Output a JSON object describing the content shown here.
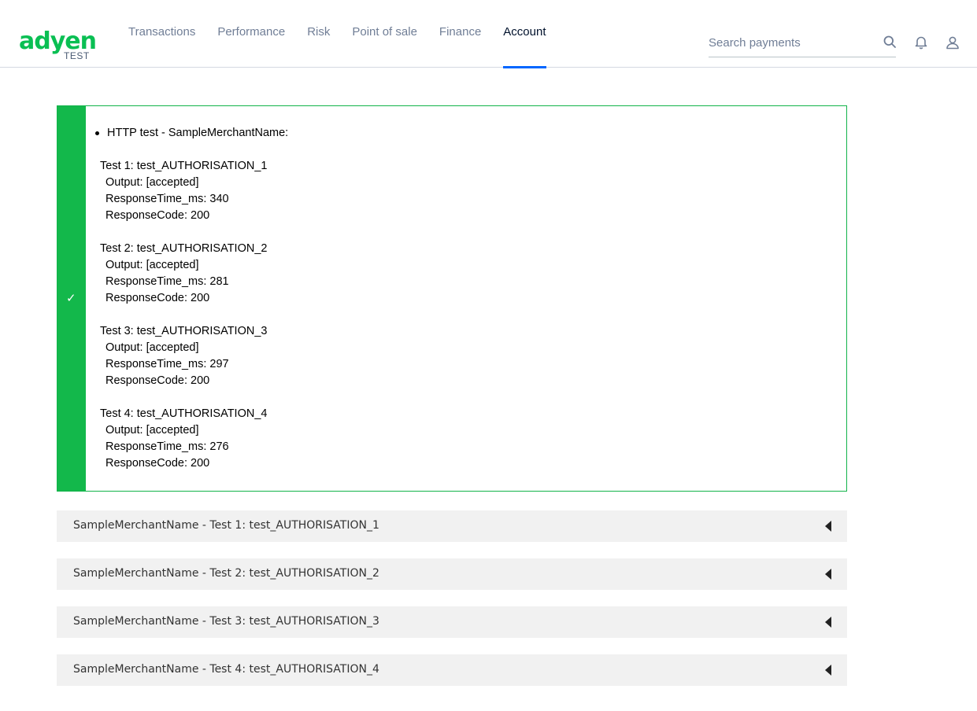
{
  "brand": {
    "logo": "adyen",
    "sub": "TEST",
    "color": "#0abf53"
  },
  "nav": [
    {
      "label": "Transactions",
      "active": false
    },
    {
      "label": "Performance",
      "active": false
    },
    {
      "label": "Risk",
      "active": false
    },
    {
      "label": "Point of sale",
      "active": false
    },
    {
      "label": "Finance",
      "active": false
    },
    {
      "label": "Account",
      "active": true
    }
  ],
  "search": {
    "placeholder": "Search payments",
    "value": ""
  },
  "icons": {
    "search": "search-icon",
    "notifications": "bell-icon",
    "user": "user-icon",
    "status": "check-icon",
    "expand": "triangle-left-icon"
  },
  "result": {
    "status": "success",
    "status_color": "#13b84b",
    "check": "✓",
    "heading": "HTTP test - SampleMerchantName:",
    "tests": [
      {
        "title": "Test 1: test_AUTHORISATION_1",
        "output": "Output: [accepted]",
        "response_time": "ResponseTime_ms: 340",
        "response_code": "ResponseCode: 200"
      },
      {
        "title": "Test 2: test_AUTHORISATION_2",
        "output": "Output: [accepted]",
        "response_time": "ResponseTime_ms: 281",
        "response_code": "ResponseCode: 200"
      },
      {
        "title": "Test 3: test_AUTHORISATION_3",
        "output": "Output: [accepted]",
        "response_time": "ResponseTime_ms: 297",
        "response_code": "ResponseCode: 200"
      },
      {
        "title": "Test 4: test_AUTHORISATION_4",
        "output": "Output: [accepted]",
        "response_time": "ResponseTime_ms: 276",
        "response_code": "ResponseCode: 200"
      }
    ]
  },
  "accordions": [
    {
      "label": "SampleMerchantName - Test 1: test_AUTHORISATION_1"
    },
    {
      "label": "SampleMerchantName - Test 2: test_AUTHORISATION_2"
    },
    {
      "label": "SampleMerchantName - Test 3: test_AUTHORISATION_3"
    },
    {
      "label": "SampleMerchantName - Test 4: test_AUTHORISATION_4"
    }
  ]
}
